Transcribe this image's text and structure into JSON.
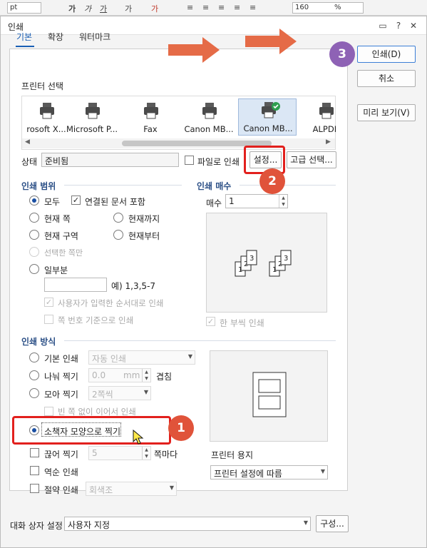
{
  "app_toolbar": {
    "unit": "pt",
    "zoom": "160",
    "zoom_unit": "%"
  },
  "dialog": {
    "title": "인쇄"
  },
  "tabs": [
    {
      "label": "기본"
    },
    {
      "label": "확장"
    },
    {
      "label": "워터마크"
    }
  ],
  "printer_section": {
    "title": "프린터 선택",
    "printers": [
      "rosoft X...",
      "Microsoft P...",
      "Fax",
      "Canon MB...",
      "Canon MB...",
      "ALPDF"
    ],
    "status_label": "상태",
    "status_value": "준비됨",
    "print_to_file": "파일로 인쇄",
    "settings_button": "설정...",
    "advanced_button": "고급 선택..."
  },
  "print_range": {
    "title": "인쇄 범위",
    "all": "모두",
    "include_linked": "연결된 문서 포함",
    "current_page": "현재 쪽",
    "to_current": "현재까지",
    "current_section": "현재 구역",
    "from_current": "현재부터",
    "selected_pages": "선택한 쪽만",
    "partial": "일부분",
    "partial_example": "예) 1,3,5-7",
    "user_order": "사용자가 입력한 순서대로 인쇄",
    "by_page_number": "쪽 번호 기준으로 인쇄"
  },
  "copies": {
    "title": "인쇄 매수",
    "label": "매수",
    "value": "1",
    "collate": "한 부씩 인쇄"
  },
  "print_method": {
    "title": "인쇄 방식",
    "basic": "기본 인쇄",
    "basic_option": "자동 인쇄",
    "split": "나눠 찍기",
    "split_value": "0.0",
    "split_unit": "mm",
    "overlap": "겹침",
    "gather": "모아 찍기",
    "gather_option": "2쪽씩",
    "no_blank": "빈 쪽 없이 이어서 인쇄",
    "booklet": "소책자 모양으로 찍기",
    "cut": "끊어 찍기",
    "cut_value": "5",
    "cut_suffix": "쪽마다",
    "reverse": "역순 인쇄",
    "saving": "절약 인쇄",
    "saving_option": "회색조",
    "paper_label": "프린터 용지",
    "paper_option": "프린터 설정에 따름"
  },
  "side_buttons": {
    "print": "인쇄(D)",
    "cancel": "취소",
    "preview": "미리 보기(V)"
  },
  "bottom": {
    "label": "대화 상자 설정",
    "option": "사용자 지정",
    "configure": "구성..."
  },
  "annotations": {
    "badge1": "1",
    "badge2": "2",
    "badge3": "3"
  }
}
